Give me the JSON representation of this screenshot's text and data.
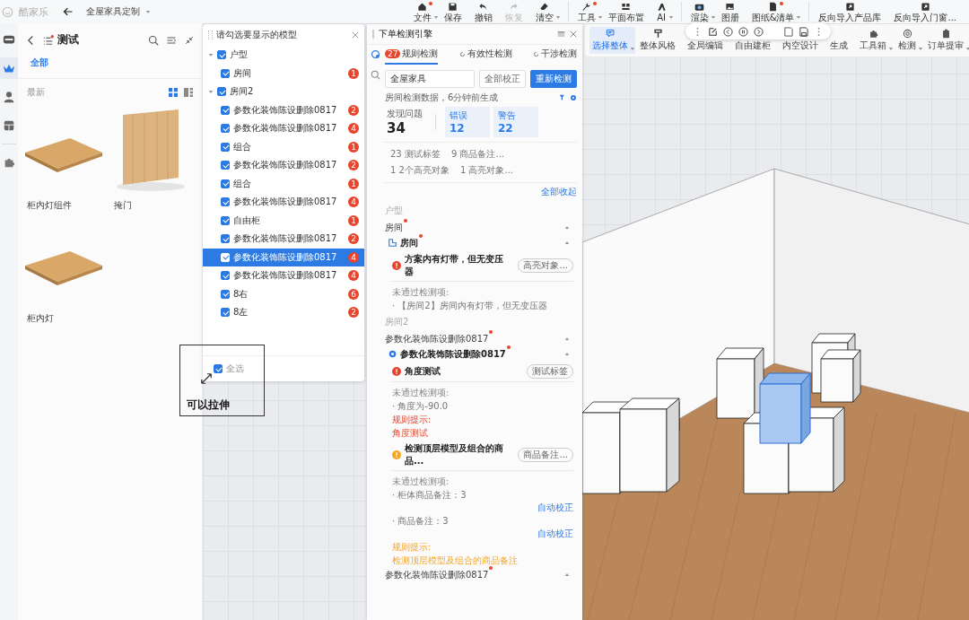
{
  "header": {
    "logo": "酷家乐",
    "project": "全屋家具定制"
  },
  "toolbar_groups": [
    [
      {
        "label": "文件",
        "kind": "home",
        "dot": true,
        "menu": true,
        "disabled": false
      },
      {
        "label": "保存",
        "kind": "save",
        "dot": false,
        "menu": false,
        "disabled": false
      },
      {
        "label": "撤销",
        "kind": "undo",
        "dot": false,
        "menu": false,
        "disabled": false
      },
      {
        "label": "恢复",
        "kind": "redo",
        "dot": false,
        "menu": false,
        "disabled": true
      },
      {
        "label": "清空",
        "kind": "eraser",
        "dot": false,
        "menu": true,
        "disabled": false
      }
    ],
    [
      {
        "label": "工具",
        "kind": "wrench",
        "dot": true,
        "menu": true,
        "disabled": false
      },
      {
        "label": "平面布置",
        "kind": "layout",
        "dot": false,
        "menu": false,
        "disabled": false
      },
      {
        "label": "AI",
        "kind": "ai",
        "dot": false,
        "menu": true,
        "disabled": false
      }
    ],
    [
      {
        "label": "渲染",
        "kind": "camera",
        "dot": false,
        "menu": true,
        "disabled": false
      },
      {
        "label": "图册",
        "kind": "picture",
        "dot": false,
        "menu": false,
        "disabled": false
      },
      {
        "label": "图纸&清单",
        "kind": "document",
        "dot": true,
        "menu": true,
        "disabled": false
      }
    ],
    [
      {
        "label": "反向导入产品库",
        "kind": "import",
        "dot": false,
        "menu": false,
        "disabled": false
      },
      {
        "label": "反向导入门窗...",
        "kind": "import",
        "dot": false,
        "menu": false,
        "disabled": false
      }
    ]
  ],
  "toolbar2": [
    {
      "label": "选择整体",
      "kind": "select",
      "selected": true,
      "menu": true
    },
    {
      "label": "整体风格",
      "kind": "brush",
      "selected": false,
      "menu": false
    },
    {
      "label": "全局编辑",
      "kind": "plain",
      "selected": false,
      "menu": false
    },
    {
      "label": "自由建柜",
      "kind": "plain",
      "selected": false,
      "menu": false
    },
    {
      "label": "内空设计",
      "kind": "plain",
      "selected": false,
      "menu": false
    },
    {
      "label": "生成",
      "kind": "plain",
      "selected": false,
      "menu": false
    },
    {
      "label": "工具箱",
      "kind": "puzzle",
      "selected": false,
      "menu": true
    },
    {
      "label": "检测",
      "kind": "target",
      "selected": false,
      "menu": true
    },
    {
      "label": "订单提审",
      "kind": "clipboard",
      "selected": false,
      "menu": true
    }
  ],
  "rail": [
    {
      "kind": "box",
      "selected": false
    },
    {
      "kind": "crown",
      "selected": true
    },
    {
      "kind": "person",
      "selected": false
    },
    {
      "kind": "cabinet",
      "selected": false
    },
    {
      "kind": "puzzle",
      "selected": false
    }
  ],
  "library": {
    "title": "测试",
    "title_dot": true,
    "tabs": [
      {
        "label": "全部",
        "selected": true
      }
    ],
    "sort": "最新",
    "views": [
      {
        "kind": "grid",
        "selected": true
      },
      {
        "kind": "list",
        "selected": false
      }
    ],
    "items": [
      {
        "name": "柜内灯组件",
        "kind": "board"
      },
      {
        "name": "掩门",
        "kind": "door"
      },
      {
        "name": "柜内灯",
        "kind": "board"
      }
    ]
  },
  "model_panel": {
    "title": "请勾选要显示的模型",
    "tree": [
      {
        "label": "户型",
        "checked": true,
        "expanded": true,
        "children": [
          {
            "label": "房间",
            "checked": true,
            "count": "1",
            "selected": false
          }
        ]
      },
      {
        "label": "房间2",
        "checked": true,
        "expanded": true,
        "children": [
          {
            "label": "参数化装饰陈设删除0817",
            "checked": true,
            "count": "2",
            "selected": false
          },
          {
            "label": "参数化装饰陈设删除0817",
            "checked": true,
            "count": "4",
            "selected": false
          },
          {
            "label": "组合",
            "checked": true,
            "count": "1",
            "selected": false
          },
          {
            "label": "参数化装饰陈设删除0817",
            "checked": true,
            "count": "2",
            "selected": false
          },
          {
            "label": "组合",
            "checked": true,
            "count": "1",
            "selected": false
          },
          {
            "label": "参数化装饰陈设删除0817",
            "checked": true,
            "count": "4",
            "selected": false
          },
          {
            "label": "自由柜",
            "checked": true,
            "count": "1",
            "selected": false
          },
          {
            "label": "参数化装饰陈设删除0817",
            "checked": true,
            "count": "2",
            "selected": false
          },
          {
            "label": "参数化装饰陈设删除0817",
            "checked": true,
            "count": "4",
            "selected": true
          },
          {
            "label": "参数化装饰陈设删除0817",
            "checked": true,
            "count": "4",
            "selected": false
          },
          {
            "label": "8右",
            "checked": true,
            "count": "6",
            "selected": false
          },
          {
            "label": "8左",
            "checked": true,
            "count": "2",
            "selected": false
          }
        ]
      }
    ],
    "select_all": {
      "label": "全选",
      "checked": true
    }
  },
  "annotation": {
    "text": "可以拉伸"
  },
  "check_panel": {
    "title": "下单检测引擎",
    "tabs": [
      {
        "label": "规则检测",
        "badge": "27",
        "selected": true
      },
      {
        "label": "有效性检测",
        "selected": false
      },
      {
        "label": "干涉检测",
        "selected": false
      }
    ],
    "scope": "全屋家具",
    "buttons": [
      {
        "label": "全部校正",
        "primary": false
      },
      {
        "label": "重新检测",
        "primary": true
      }
    ],
    "generated": "房间检测数据，6分钟前生成",
    "summary": {
      "label": "发现问题",
      "value": "34",
      "stats": [
        {
          "label": "错误",
          "value": "12"
        },
        {
          "label": "警告",
          "value": "22"
        }
      ]
    },
    "filters": [
      "23 测试标签",
      "9 商品备注...",
      "1 2个高亮对象",
      "1 高亮对象..."
    ],
    "collapse_all": "全部收起",
    "groups": [
      {
        "heading": "户型",
        "items": [
          {
            "name": "房间",
            "dot": true,
            "expanded": true,
            "children": [
              {
                "name": "房间",
                "kind": "room",
                "dot": true,
                "expanded": true,
                "issues": [
                  {
                    "kind": "error",
                    "title": "方案内有灯带，但无变压器",
                    "tag": "高亮对象...",
                    "failed_label": "未通过检测项:",
                    "failed": [
                      {
                        "text": "· 【房间2】房间内有灯带，但无变压器"
                      }
                    ]
                  }
                ]
              }
            ]
          }
        ]
      },
      {
        "heading": "房间2",
        "items": [
          {
            "name": "参数化装饰陈设删除0817",
            "dot": true,
            "expanded": true,
            "children": [
              {
                "name": "参数化装饰陈设删除0817",
                "kind": "object",
                "dot": true,
                "expanded": true,
                "issues": [
                  {
                    "kind": "error",
                    "title": "角度测试",
                    "tag": "测试标签",
                    "failed_label": "未通过检测项:",
                    "failed": [
                      {
                        "text": "· 角度为-90.0"
                      }
                    ],
                    "hint_label": "规则提示:",
                    "hint": "角度测试"
                  },
                  {
                    "kind": "warning",
                    "title": "检测顶层模型及组合的商品...",
                    "tag": "商品备注...",
                    "failed_label": "未通过检测项:",
                    "failed": [
                      {
                        "text": "· 柜体商品备注：3",
                        "fix": "自动校正"
                      },
                      {
                        "text": "· 商品备注：3",
                        "fix": "自动校正"
                      }
                    ],
                    "hint_label": "规则提示:",
                    "hint": "检测顶层模型及组合的商品备注"
                  }
                ]
              }
            ]
          },
          {
            "name": "参数化装饰陈设删除0817",
            "dot": true,
            "expanded": true
          }
        ]
      }
    ]
  }
}
